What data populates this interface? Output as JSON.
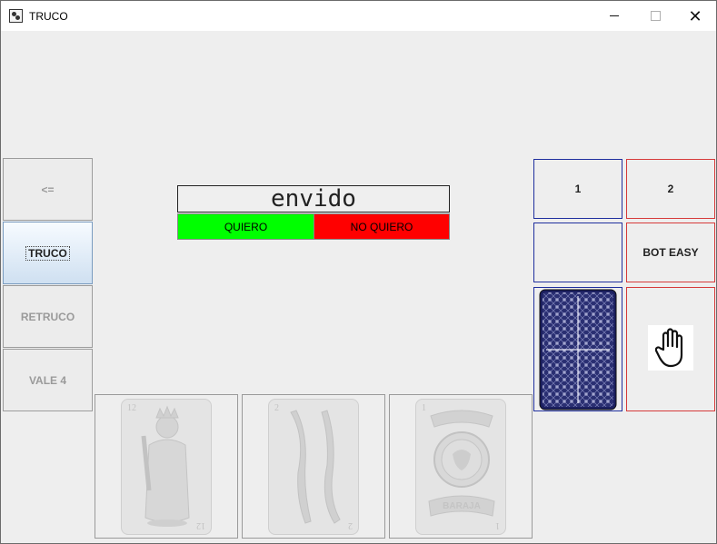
{
  "window": {
    "title": "TRUCO",
    "icon": "card-app-icon"
  },
  "left_panel": {
    "back": "<=",
    "truco": "TRUCO",
    "retruco": "RETRUCO",
    "vale4": "VALE 4"
  },
  "call": {
    "text": "envido",
    "quiero": "QUIERO",
    "no_quiero": "NO QUIERO"
  },
  "right_panel": {
    "player1": "1",
    "player2": "2",
    "bot_label": "BOT EASY",
    "bot_icon": "hand-icon"
  },
  "hand_cards": [
    {
      "number": "12",
      "suit": "bastos"
    },
    {
      "number": "2",
      "suit": "espadas"
    },
    {
      "number": "1",
      "suit": "oros",
      "label": "BARAJA"
    }
  ],
  "colors": {
    "quiero": "#00ff00",
    "no_quiero": "#ff0000",
    "card_back": "#2a2f72",
    "player1_border": "#1f2f9e",
    "player2_border": "#d63a3a"
  }
}
